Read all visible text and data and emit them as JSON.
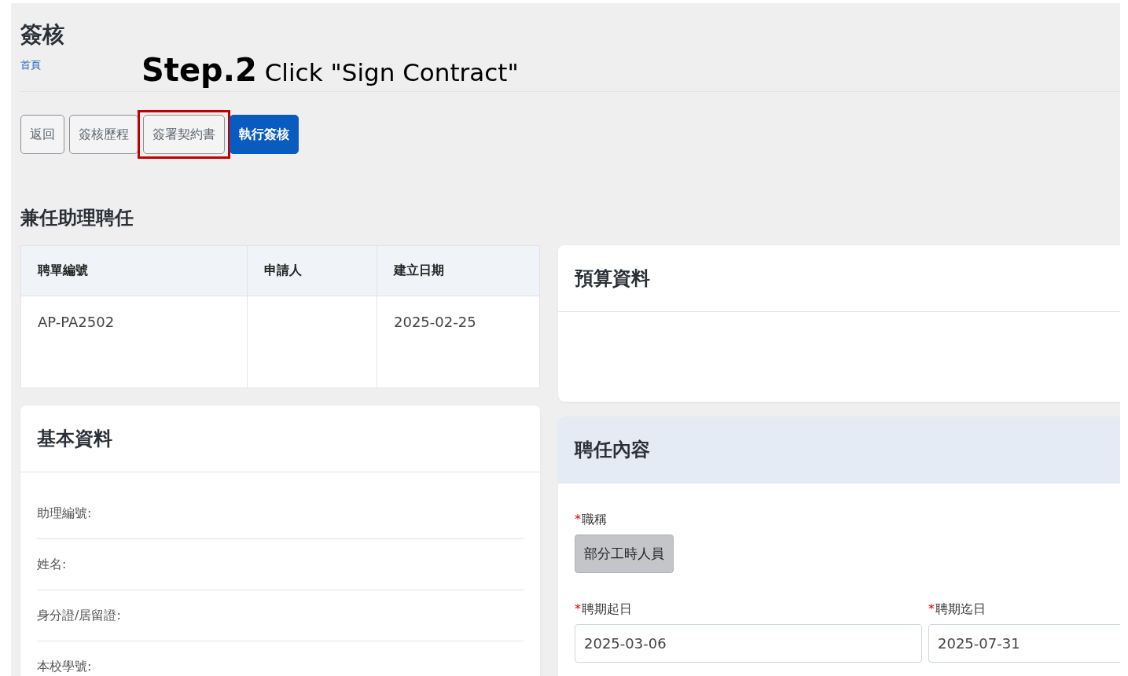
{
  "page": {
    "title": "簽核",
    "breadcrumb": "首頁"
  },
  "annotation": {
    "step": "Step.2",
    "instruction": "Click \"Sign Contract\""
  },
  "actions": [
    {
      "label": "返回",
      "kind": "outline",
      "highlighted": false
    },
    {
      "label": "簽核歷程",
      "kind": "outline",
      "highlighted": false
    },
    {
      "label": "簽署契約書",
      "kind": "outline",
      "highlighted": true
    },
    {
      "label": "執行簽核",
      "kind": "primary",
      "highlighted": false
    }
  ],
  "section_title": "兼任助理聘任",
  "summary_table": {
    "columns": [
      "聘單編號",
      "申請人",
      "建立日期"
    ],
    "rows": [
      [
        "AP-PA2502",
        "",
        "2025-02-25"
      ]
    ]
  },
  "basic_info": {
    "title": "基本資料",
    "fields": [
      {
        "label": "助理編號:"
      },
      {
        "label": "姓名:"
      },
      {
        "label": "身分證/居留證:"
      },
      {
        "label": "本校學號:"
      }
    ]
  },
  "budget": {
    "title": "預算資料"
  },
  "appointment": {
    "title": "聘任內容",
    "job_title": {
      "label": "職稱",
      "required_mark": "*",
      "value": "部分工時人員"
    },
    "dates": [
      {
        "label": "聘期起日",
        "required_mark": "*",
        "value": "2025-03-06"
      },
      {
        "label": "聘期迄日",
        "required_mark": "*",
        "value": "2025-07-31"
      }
    ]
  }
}
